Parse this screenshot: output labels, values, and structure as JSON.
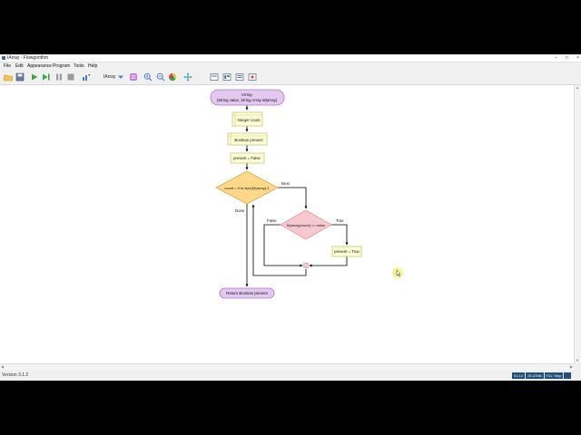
{
  "window": {
    "title": "IArray - Flowgorithm",
    "controls": {
      "minimize": "–",
      "maximize": "□",
      "close": "×"
    }
  },
  "menu": [
    "File",
    "Edit",
    "Appearance",
    "Program",
    "Tools",
    "Help"
  ],
  "toolbar": {
    "function_selector": "IArray",
    "icons": [
      "open-folder-icon",
      "save-icon",
      "run-icon",
      "step-icon",
      "pause-icon",
      "stop-icon",
      "variable-watch-icon",
      "console-icon",
      "zoom-in-icon",
      "zoom-out-icon",
      "color-icon",
      "move-icon",
      "layout-icon-1",
      "layout-icon-2",
      "layout-icon-3",
      "layout-icon-4"
    ]
  },
  "flowchart": {
    "start": {
      "line1": "IArray",
      "line2": "(String value, String Array M)array)"
    },
    "declare_count": "Integer count",
    "declare_present": "Boolean present",
    "assign_present_false": "present = False",
    "loop": "count = 0 to size(M)array)-1",
    "loop_next_label": "Next",
    "loop_done_label": "Done",
    "if_condition": "M)array[count] == value",
    "if_false_label": "False",
    "if_true_label": "True",
    "assign_present_true": "present = True",
    "end": "Return Boolean present"
  },
  "statusbar": {
    "version": "Version 3.1.2",
    "fields": [
      "01:12",
      "25.37Mb",
      "F11: Step"
    ]
  },
  "colors": {
    "terminal_fill": "#e3c8f0",
    "terminal_stroke": "#b078c8",
    "declare_fill": "#ffffd6",
    "declare_stroke": "#c9c77a",
    "loop_fill": "#ffd88a",
    "loop_stroke": "#d8a850",
    "if_fill": "#f6c9cf",
    "if_stroke": "#d99aa4",
    "status_box": "#1f4f7a"
  }
}
